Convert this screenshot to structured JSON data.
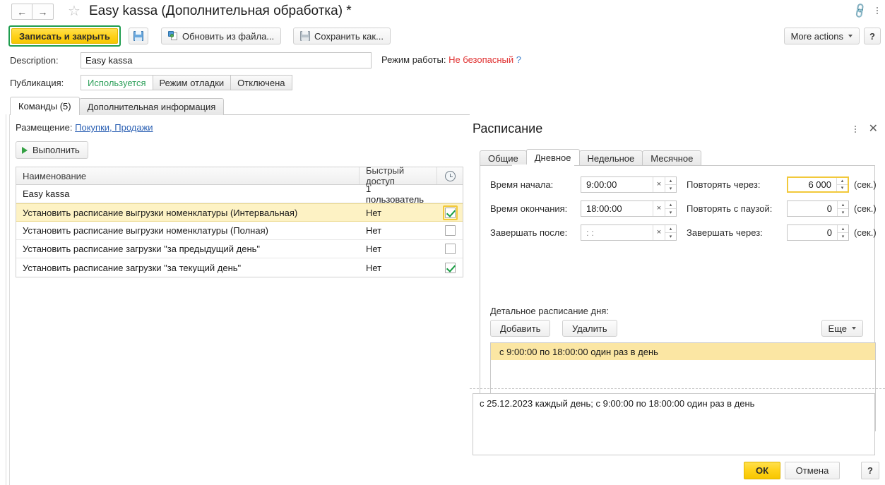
{
  "window": {
    "title": "Easy kassa (Дополнительная обработка) *",
    "back_icon": "←",
    "forward_icon": "→",
    "favorite_icon": "star-outline-icon",
    "link_icon": "link-icon",
    "kebab_icon": "kebab-menu-icon"
  },
  "toolbar": {
    "save_and_close": "Записать и закрыть",
    "save_icon_label": "save-floppy-icon",
    "update_from_file": "Обновить из файла...",
    "save_as": "Сохранить как...",
    "more_actions": "More actions",
    "help": "?"
  },
  "form": {
    "description_label": "Description:",
    "description_value": "Easy kassa",
    "description_placeholder": "",
    "workmode_label": "Режим работы:",
    "workmode_value": "Не безопасный",
    "workmode_help": "?",
    "workmode_color": "#e03030",
    "publication_label": "Публикация:",
    "publication_options": [
      "Используется",
      "Режим отладки",
      "Отключена"
    ],
    "publication_selected": "Используется",
    "publication_active_color": "#2ea05a"
  },
  "tabs": {
    "items": [
      "Команды (5)",
      "Дополнительная информация"
    ],
    "selected": "Команды (5)"
  },
  "placement": {
    "label": "Размещение:",
    "link": "Покупки, Продажи"
  },
  "execute_button": {
    "label": "Выполнить",
    "icon": "play-icon"
  },
  "table": {
    "columns": [
      "Наименование",
      "Быстрый доступ",
      "clock-icon"
    ],
    "rows": [
      {
        "name": "Easy kassa",
        "quick_access": "1 пользователь",
        "checked": null,
        "selected": false
      },
      {
        "name": "Установить расписание выгрузки номенклатуры (Интервальная)",
        "quick_access": "Нет",
        "checked": true,
        "selected": true
      },
      {
        "name": "Установить расписание выгрузки номенклатуры (Полная)",
        "quick_access": "Нет",
        "checked": false,
        "selected": false
      },
      {
        "name": "Установить расписание загрузки \"за предыдущий день\"",
        "quick_access": "Нет",
        "checked": false,
        "selected": false
      },
      {
        "name": "Установить расписание загрузки \"за текущий день\"",
        "quick_access": "Нет",
        "checked": true,
        "selected": false
      }
    ]
  },
  "schedule_panel": {
    "title": "Расписание",
    "kebab_icon": "kebab-menu-icon",
    "close_icon": "close-icon",
    "tabs": [
      "Общие",
      "Дневное",
      "Недельное",
      "Месячное"
    ],
    "selected_tab": "Дневное",
    "fields": {
      "start_time_label": "Время начала:",
      "start_time_value": "9:00:00",
      "end_time_label": "Время окончания:",
      "end_time_value": "18:00:00",
      "complete_after_label": "Завершать после:",
      "complete_after_value": ":  :",
      "repeat_every_label": "Повторять через:",
      "repeat_every_value": "6 000",
      "repeat_pause_label": "Повторять с паузой:",
      "repeat_pause_value": "0",
      "complete_in_label": "Завершать через:",
      "complete_in_value": "0",
      "unit": "(сек.)",
      "clear_icon": "×",
      "spinner_up": "▴",
      "spinner_down": "▾"
    },
    "detail_label": "Детальное расписание дня:",
    "add_button": "Добавить",
    "delete_button": "Удалить",
    "more_button": "Еще",
    "list_items": [
      "с 9:00:00 по 18:00:00 один раз в день"
    ],
    "summary": "с 25.12.2023 каждый день; с 9:00:00 по 18:00:00 один раз в день",
    "ok_button": "ОК",
    "cancel_button": "Отмена",
    "help_button": "?"
  },
  "colors": {
    "accent_yellow": "#ffd21a",
    "focus_yellow": "#f2c93b",
    "selected_row": "#fdf2c4",
    "green_border": "#1f9d4f",
    "link_blue": "#2c61b4"
  }
}
